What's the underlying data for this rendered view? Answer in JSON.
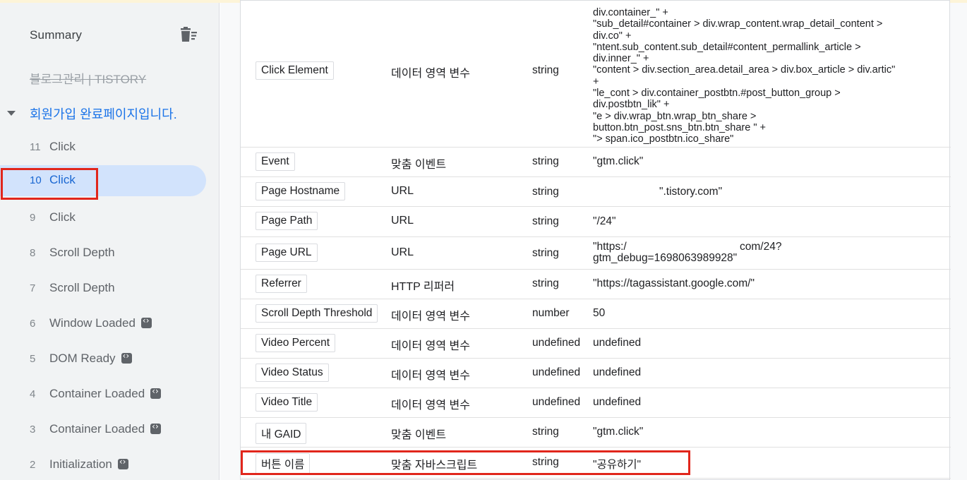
{
  "sidebar": {
    "summary_label": "Summary",
    "blog_title": "블로그관리 | TISTORY",
    "page_title": "회원가입 완료페이지입니다.",
    "events": [
      {
        "num": "11",
        "name": "Click",
        "code": false
      },
      {
        "num": "10",
        "name": "Click",
        "code": false
      },
      {
        "num": "9",
        "name": "Click",
        "code": false
      },
      {
        "num": "8",
        "name": "Scroll Depth",
        "code": false
      },
      {
        "num": "7",
        "name": "Scroll Depth",
        "code": false
      },
      {
        "num": "6",
        "name": "Window Loaded",
        "code": true
      },
      {
        "num": "5",
        "name": "DOM Ready",
        "code": true
      },
      {
        "num": "4",
        "name": "Container Loaded",
        "code": true
      },
      {
        "num": "3",
        "name": "Container Loaded",
        "code": true
      },
      {
        "num": "2",
        "name": "Initialization",
        "code": true
      }
    ]
  },
  "variables": {
    "click_element": {
      "name": "Click Element",
      "type": "데이터 영역 변수",
      "return_type": "string",
      "value_lines": [
        "div.container_\" +",
        "\"sub_detail#container > div.wrap_content.wrap_detail_content >",
        "div.co\" +",
        "\"ntent.sub_content.sub_detail#content_permallink_article >",
        "div.inner_\" +",
        "\"content > div.section_area.detail_area > div.box_article > div.artic\"",
        "+",
        "\"le_cont > div.container_postbtn.#post_button_group >",
        "div.postbtn_lik\" +",
        "\"e > div.wrap_btn.wrap_btn_share >",
        "button.btn_post.sns_btn.btn_share \" +",
        "\"> span.ico_postbtn.ico_share\""
      ]
    },
    "rows": [
      {
        "name": "Event",
        "type": "맞춤 이벤트",
        "return_type": "string",
        "value": "\"gtm.click\""
      },
      {
        "name": "Page Hostname",
        "type": "URL",
        "return_type": "string",
        "value": "\".tistory.com\""
      },
      {
        "name": "Page Path",
        "type": "URL",
        "return_type": "string",
        "value": "\"/24\""
      },
      {
        "name": "Page URL",
        "type": "URL",
        "return_type": "string",
        "value": "\"https:/",
        "value_b": "com/24?",
        "value_c": "gtm_debug=1698063989928\""
      },
      {
        "name": "Referrer",
        "type": "HTTP 리퍼러",
        "return_type": "string",
        "value": "\"https://tagassistant.google.com/\""
      },
      {
        "name": "Scroll Depth Threshold",
        "type": "데이터 영역 변수",
        "return_type": "number",
        "value": "50"
      },
      {
        "name": "Video Percent",
        "type": "데이터 영역 변수",
        "return_type": "undefined",
        "value": "undefined"
      },
      {
        "name": "Video Status",
        "type": "데이터 영역 변수",
        "return_type": "undefined",
        "value": "undefined"
      },
      {
        "name": "Video Title",
        "type": "데이터 영역 변수",
        "return_type": "undefined",
        "value": "undefined"
      },
      {
        "name": "내 GAID",
        "type": "맞춤 이벤트",
        "return_type": "string",
        "value": "\"gtm.click\""
      },
      {
        "name": "버튼 이름",
        "type": "맞춤 자바스크립트",
        "return_type": "string",
        "value": "\"공유하기\""
      }
    ]
  },
  "colors": {
    "accent": "#1a73e8",
    "active_bg": "#d2e3fc",
    "highlight": "#e1261c",
    "sidebar_bg": "#f1f3f4"
  }
}
